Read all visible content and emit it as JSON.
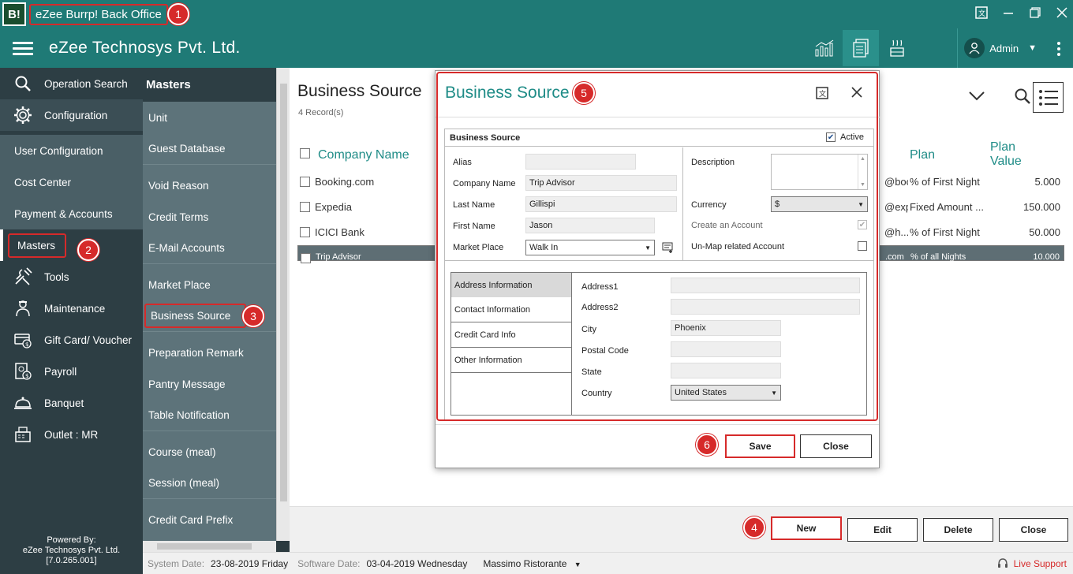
{
  "app": {
    "logo_text": "B!",
    "title": "eZee Burrp! Back Office",
    "company": "eZee Technosys Pvt. Ltd.",
    "user": "Admin"
  },
  "leftnav": {
    "items": [
      {
        "label": "Operation Search",
        "icon": "search-icon"
      },
      {
        "label": "Configuration",
        "icon": "gear-icon"
      }
    ],
    "config_sub": [
      "User Configuration",
      "Cost Center",
      "Payment & Accounts",
      "Masters"
    ],
    "items2": [
      {
        "label": "Tools",
        "icon": "tools-icon"
      },
      {
        "label": "Maintenance",
        "icon": "maintenance-icon"
      },
      {
        "label": "Gift Card/ Voucher",
        "icon": "gift-card-icon"
      },
      {
        "label": "Payroll",
        "icon": "payroll-icon"
      },
      {
        "label": "Banquet",
        "icon": "banquet-icon"
      },
      {
        "label": "Outlet : MR",
        "icon": "outlet-icon"
      }
    ],
    "powered_by": "Powered By:",
    "powered_company": "eZee Technosys Pvt. Ltd.",
    "version": "[7.0.265.001]"
  },
  "masters": {
    "heading": "Masters",
    "items": [
      "Unit",
      "Guest Database",
      "Void Reason",
      "Credit Terms",
      "E-Mail Accounts",
      "Market Place",
      "Business Source",
      "Preparation Remark",
      "Pantry Message",
      "Table Notification",
      "Course (meal)",
      "Session (meal)",
      "Credit Card Prefix"
    ]
  },
  "main": {
    "title": "Business Source",
    "record_count": "4 Record(s)",
    "columns": {
      "company": "Company Name",
      "plan": "Plan",
      "plan_value_1": "Plan",
      "plan_value_2": "Value"
    },
    "rows": [
      {
        "company": "Booking.com",
        "email": "@booki...",
        "plan": "% of First Night",
        "value": "5.000"
      },
      {
        "company": "Expedia",
        "email": "@expe...",
        "plan": "Fixed Amount ...",
        "value": "150.000"
      },
      {
        "company": "ICICI Bank",
        "email": "@h...",
        "plan": "% of First Night",
        "value": "50.000"
      },
      {
        "company": "Trip Advisor",
        "email": ".com",
        "plan": "% of all Nights",
        "value": "10.000"
      }
    ]
  },
  "buttons": {
    "new": "New",
    "edit": "Edit",
    "delete": "Delete",
    "close": "Close"
  },
  "dialog": {
    "title": "Business Source",
    "section": "Business Source",
    "active_label": "Active",
    "labels": {
      "alias": "Alias",
      "company": "Company Name",
      "last_name": "Last Name",
      "first_name": "First Name",
      "market_place": "Market Place",
      "description": "Description",
      "currency": "Currency",
      "create_account": "Create an Account",
      "unmap": "Un-Map related Account"
    },
    "values": {
      "alias": "",
      "company": "Trip Advisor",
      "last_name": "Gillispi",
      "first_name": "Jason",
      "market_place": "Walk In",
      "currency": "$"
    },
    "tabs": [
      "Address Information",
      "Contact Information",
      "Credit Card Info",
      "Other Information"
    ],
    "address": {
      "labels": {
        "address1": "Address1",
        "address2": "Address2",
        "city": "City",
        "postal": "Postal Code",
        "state": "State",
        "country": "Country"
      },
      "values": {
        "address1": "",
        "address2": "",
        "city": "Phoenix",
        "postal": "",
        "state": "",
        "country": "United States"
      }
    },
    "save": "Save",
    "close": "Close"
  },
  "badges": [
    "1",
    "2",
    "3",
    "4",
    "5",
    "6"
  ],
  "status": {
    "system_date_label": "System Date:",
    "system_date": "23-08-2019 Friday",
    "software_date_label": "Software Date:",
    "software_date": "03-04-2019 Wednesday",
    "outlet": "Massimo Ristorante",
    "live_support": "Live Support"
  },
  "colors": {
    "teal": "#1f7a76",
    "accent": "#1f8c87",
    "highlight": "#d62a2a",
    "nav_dark": "#2d3e44"
  }
}
